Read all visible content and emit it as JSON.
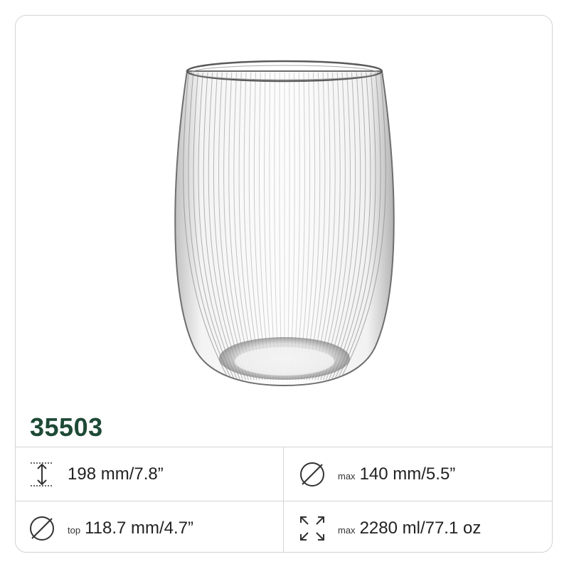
{
  "product": {
    "code": "35503",
    "image_alt": "ribbed stemless glass"
  },
  "specs": {
    "height": {
      "icon": "height-arrow-icon",
      "value": "198 mm/7.8”"
    },
    "max_diameter": {
      "icon": "diameter-icon",
      "prefix": "max",
      "value": "140 mm/5.5”"
    },
    "top_diameter": {
      "icon": "diameter-icon",
      "prefix": "top",
      "value": "118.7 mm/4.7”"
    },
    "capacity": {
      "icon": "expand-arrows-icon",
      "prefix": "max",
      "value": "2280 ml/77.1 oz"
    }
  },
  "colors": {
    "brand_green": "#1e4a36",
    "border": "#d4d4d4"
  }
}
